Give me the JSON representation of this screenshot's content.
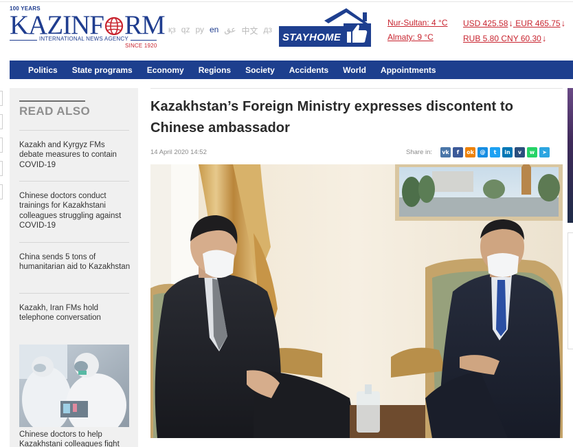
{
  "header": {
    "logo": {
      "years": "100 YEARS",
      "brand_left": "KAZINF",
      "brand_right": "RM",
      "agency": "INTERNATIONAL NEWS AGENCY",
      "since": "SINCE 1920"
    },
    "languages": [
      {
        "label": "қз",
        "active": false
      },
      {
        "label": "qz",
        "active": false
      },
      {
        "label": "ру",
        "active": false
      },
      {
        "label": "en",
        "active": true
      },
      {
        "label": "عق",
        "active": false
      },
      {
        "label": "中文",
        "active": false
      },
      {
        "label": "дз",
        "active": false
      }
    ],
    "stayhome_label": "STAYHOME",
    "weather": [
      "Nur-Sultan: 4 °C",
      "Almaty: 9 °C"
    ],
    "rates": {
      "usd": "USD 425.58",
      "eur": "EUR 465.75",
      "rub": "RUB 5.80",
      "cny": "CNY 60.30",
      "down_arrow": "↓"
    }
  },
  "nav": [
    "Politics",
    "State programs",
    "Economy",
    "Regions",
    "Society",
    "Accidents",
    "World",
    "Appointments"
  ],
  "sidebar": {
    "title": "READ ALSO",
    "items": [
      "Kazakh and Kyrgyz FMs debate measures to contain COVID-19",
      "Chinese doctors conduct trainings for Kazakhstani colleagues struggling against COVID-19",
      "China sends 5 tons of humanitarian aid to Kazakhstan",
      "Kazakh, Iran FMs hold telephone conversation"
    ],
    "photo_caption": "Chinese doctors to help Kazakhstani colleagues fight"
  },
  "article": {
    "headline": "Kazakhstan’s Foreign Ministry expresses discontent to Chinese ambassador",
    "date": "14 April 2020 14:52",
    "share_label": "Share in:"
  },
  "share_buttons": [
    {
      "icon": "vk-icon",
      "glyph": "vk",
      "color": "#4a76a8"
    },
    {
      "icon": "facebook-icon",
      "glyph": "f",
      "color": "#3b5998"
    },
    {
      "icon": "odnoklassniki-icon",
      "glyph": "ok",
      "color": "#ee8208"
    },
    {
      "icon": "mailru-icon",
      "glyph": "@",
      "color": "#168de2"
    },
    {
      "icon": "twitter-icon",
      "glyph": "t",
      "color": "#1da1f2"
    },
    {
      "icon": "linkedin-icon",
      "glyph": "in",
      "color": "#0077b5"
    },
    {
      "icon": "viber-icon",
      "glyph": "v",
      "color": "#2b4f7e"
    },
    {
      "icon": "whatsapp-icon",
      "glyph": "w",
      "color": "#25d366"
    },
    {
      "icon": "telegram-icon",
      "glyph": "➤",
      "color": "#2ca5e0"
    }
  ],
  "colors": {
    "brand_blue": "#1f3d8f",
    "nav_blue": "#1d3f8e",
    "accent_red": "#c8242f"
  }
}
